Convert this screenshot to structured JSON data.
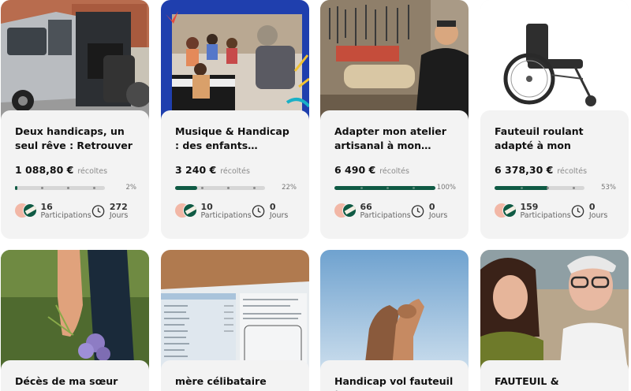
{
  "cards": [
    {
      "title": "Deux handicaps, un seul rêve : Retrouver notre…",
      "amount": "1 088,80 €",
      "recoltes": "récoltes",
      "percent": "2%",
      "progress": 0.02,
      "participations": "16",
      "participations_label": "Participations",
      "days": "272",
      "days_label": "Jours"
    },
    {
      "title": "Musique & Handicap : des enfants…",
      "amount": "3 240 €",
      "recoltes": "récoltés",
      "percent": "22%",
      "progress": 0.22,
      "participations": "10",
      "participations_label": "Participations",
      "days": "0",
      "days_label": "Jours"
    },
    {
      "title": "Adapter mon atelier artisanal à mon…",
      "amount": "6 490 €",
      "recoltes": "récoltés",
      "percent": "100%",
      "progress": 1.0,
      "participations": "66",
      "participations_label": "Participations",
      "days": "0",
      "days_label": "Jours"
    },
    {
      "title": "Fauteuil roulant adapté à mon handicap &…",
      "amount": "6 378,30 €",
      "recoltes": "récoltés",
      "percent": "53%",
      "progress": 0.53,
      "participations": "159",
      "participations_label": "Participations",
      "days": "0",
      "days_label": "Jours"
    },
    {
      "title": "Décès de ma sœur"
    },
    {
      "title": "mère célibataire"
    },
    {
      "title": "Handicap vol fauteuil à"
    },
    {
      "title": "FAUTEUIL & VEHICULE"
    }
  ]
}
